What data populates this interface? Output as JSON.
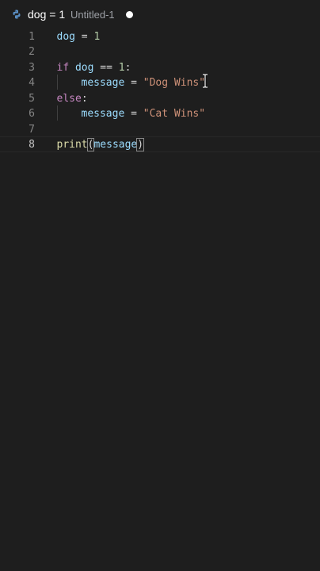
{
  "tab": {
    "title": "dog = 1",
    "description": "Untitled-1",
    "icon": "python-icon",
    "modified": true
  },
  "editor": {
    "active_line": 8,
    "lines": [
      {
        "number": "1"
      },
      {
        "number": "2"
      },
      {
        "number": "3"
      },
      {
        "number": "4"
      },
      {
        "number": "5"
      },
      {
        "number": "6"
      },
      {
        "number": "7"
      },
      {
        "number": "8"
      }
    ],
    "tokens": {
      "l1_var": "dog",
      "l1_op": " = ",
      "l1_num": "1",
      "l3_if": "if",
      "l3_var": "dog",
      "l3_op": " == ",
      "l3_num": "1",
      "l3_colon": ":",
      "l4_var": "message",
      "l4_op": " = ",
      "l4_str": "\"Dog Wins\"",
      "l5_else": "else",
      "l5_colon": ":",
      "l6_var": "message",
      "l6_op": " = ",
      "l6_str": "\"Cat Wins\"",
      "l8_fn": "print",
      "l8_open": "(",
      "l8_var": "message",
      "l8_close": ")"
    }
  },
  "colors": {
    "background": "#1e1e1e",
    "keyword": "#c586c0",
    "variable": "#9cdcfe",
    "number": "#b5cea8",
    "string": "#ce9178",
    "function": "#dcdcaa"
  },
  "cursor": "text-cursor-icon"
}
